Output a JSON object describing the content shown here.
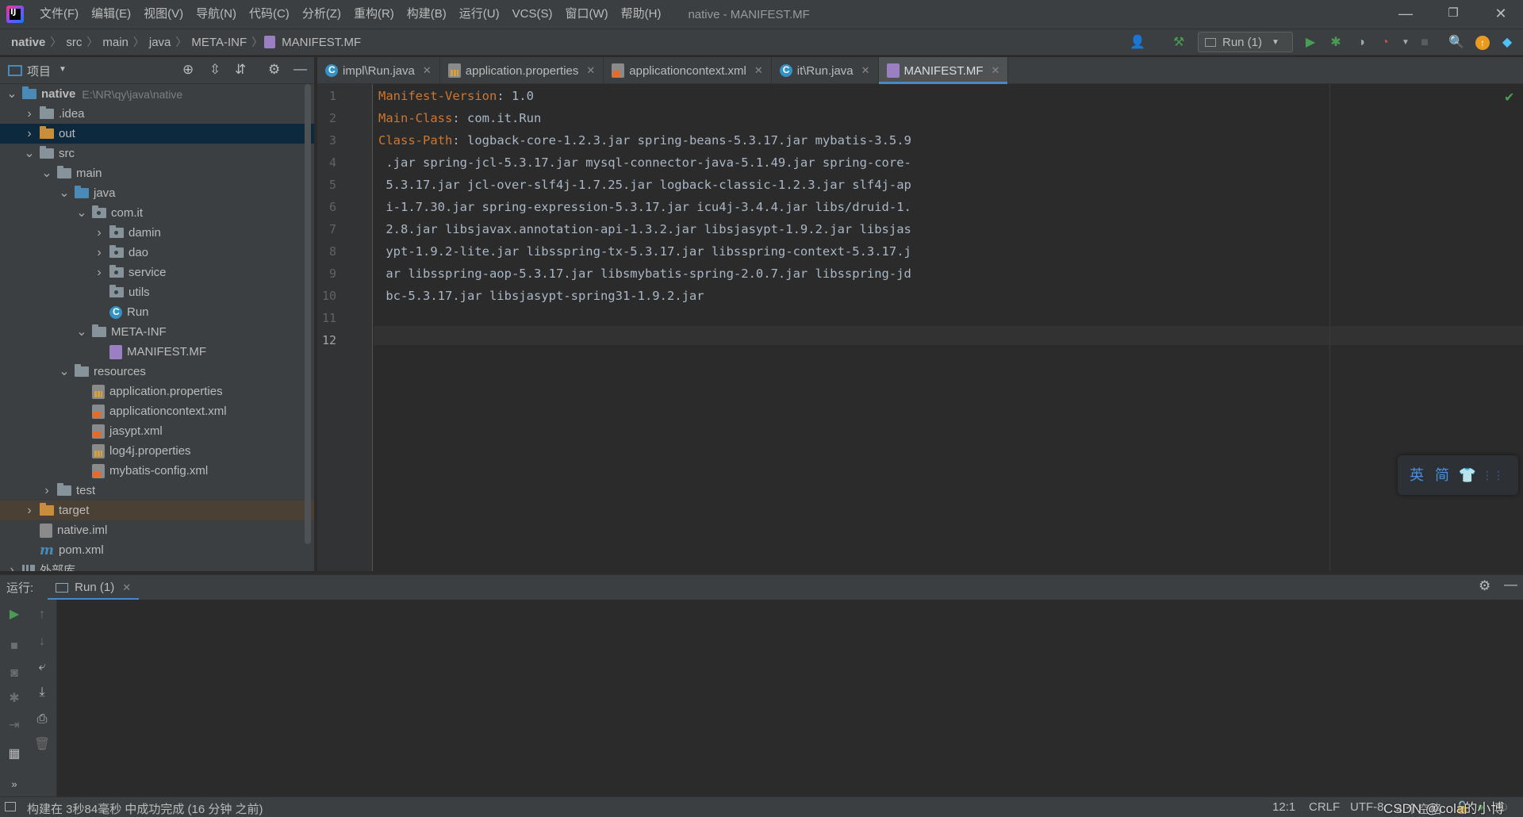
{
  "menu": [
    "文件(F)",
    "编辑(E)",
    "视图(V)",
    "导航(N)",
    "代码(C)",
    "分析(Z)",
    "重构(R)",
    "构建(B)",
    "运行(U)",
    "VCS(S)",
    "窗口(W)",
    "帮助(H)"
  ],
  "window_title": "native - MANIFEST.MF",
  "window_controls": {
    "minimize": "—",
    "restore": "❐",
    "close": "✕"
  },
  "breadcrumb": [
    "native",
    "src",
    "main",
    "java",
    "META-INF",
    "MANIFEST.MF"
  ],
  "run_config": "Run (1)",
  "project_panel": {
    "title": "项目"
  },
  "tree": [
    {
      "label": "native",
      "extra": "E:\\NR\\qy\\java\\native",
      "depth": 0,
      "arrow": "v",
      "icon": "module-folder"
    },
    {
      "label": ".idea",
      "depth": 1,
      "arrow": ">",
      "icon": "folder"
    },
    {
      "label": "out",
      "depth": 1,
      "arrow": ">",
      "icon": "folder-orange"
    },
    {
      "label": "src",
      "depth": 1,
      "arrow": "v",
      "icon": "folder"
    },
    {
      "label": "main",
      "depth": 2,
      "arrow": "v",
      "icon": "folder"
    },
    {
      "label": "java",
      "depth": 3,
      "arrow": "v",
      "icon": "folder-blue"
    },
    {
      "label": "com.it",
      "depth": 4,
      "arrow": "v",
      "icon": "package"
    },
    {
      "label": "damin",
      "depth": 5,
      "arrow": ">",
      "icon": "package"
    },
    {
      "label": "dao",
      "depth": 5,
      "arrow": ">",
      "icon": "package"
    },
    {
      "label": "service",
      "depth": 5,
      "arrow": ">",
      "icon": "package"
    },
    {
      "label": "utils",
      "depth": 5,
      "arrow": "",
      "icon": "package"
    },
    {
      "label": "Run",
      "depth": 5,
      "arrow": "",
      "icon": "java-class"
    },
    {
      "label": "META-INF",
      "depth": 4,
      "arrow": "v",
      "icon": "folder"
    },
    {
      "label": "MANIFEST.MF",
      "depth": 5,
      "arrow": "",
      "icon": "manifest-file"
    },
    {
      "label": "resources",
      "depth": 3,
      "arrow": "v",
      "icon": "resources-folder"
    },
    {
      "label": "application.properties",
      "depth": 4,
      "arrow": "",
      "icon": "properties-file"
    },
    {
      "label": "applicationcontext.xml",
      "depth": 4,
      "arrow": "",
      "icon": "xml-file"
    },
    {
      "label": "jasypt.xml",
      "depth": 4,
      "arrow": "",
      "icon": "xml-file"
    },
    {
      "label": "log4j.properties",
      "depth": 4,
      "arrow": "",
      "icon": "properties-file"
    },
    {
      "label": "mybatis-config.xml",
      "depth": 4,
      "arrow": "",
      "icon": "xml-file"
    },
    {
      "label": "test",
      "depth": 2,
      "arrow": ">",
      "icon": "folder"
    },
    {
      "label": "target",
      "depth": 1,
      "arrow": ">",
      "icon": "folder-orange"
    },
    {
      "label": "native.iml",
      "depth": 1,
      "arrow": "",
      "icon": "iml-file"
    },
    {
      "label": "pom.xml",
      "depth": 1,
      "arrow": "",
      "icon": "maven-file"
    },
    {
      "label": "外部库",
      "depth": 0,
      "arrow": ">",
      "icon": "library"
    }
  ],
  "tabs": [
    {
      "label": "impl\\Run.java",
      "icon": "java-class"
    },
    {
      "label": "application.properties",
      "icon": "properties-file"
    },
    {
      "label": "applicationcontext.xml",
      "icon": "xml-file"
    },
    {
      "label": "it\\Run.java",
      "icon": "java-class"
    },
    {
      "label": "MANIFEST.MF",
      "icon": "manifest-file",
      "active": true
    }
  ],
  "editor": {
    "line_numbers": [
      "1",
      "2",
      "3",
      "4",
      "5",
      "6",
      "7",
      "8",
      "9",
      "10",
      "11",
      "12"
    ],
    "current_line": "12",
    "lines": [
      {
        "key": "Manifest-Version",
        "rest": ": 1.0"
      },
      {
        "key": "Main-Class",
        "rest": ": com.it.Run"
      },
      {
        "key": "Class-Path",
        "rest": ": logback-core-1.2.3.jar spring-beans-5.3.17.jar mybatis-3.5.9"
      },
      {
        "key": "",
        "rest": " .jar spring-jcl-5.3.17.jar mysql-connector-java-5.1.49.jar spring-core-"
      },
      {
        "key": "",
        "rest": " 5.3.17.jar jcl-over-slf4j-1.7.25.jar logback-classic-1.2.3.jar slf4j-ap"
      },
      {
        "key": "",
        "rest": " i-1.7.30.jar spring-expression-5.3.17.jar icu4j-3.4.4.jar libs/druid-1."
      },
      {
        "key": "",
        "rest": " 2.8.jar libsjavax.annotation-api-1.3.2.jar libsjasypt-1.9.2.jar libsjas"
      },
      {
        "key": "",
        "rest": " ypt-1.9.2-lite.jar libsspring-tx-5.3.17.jar libsspring-context-5.3.17.j"
      },
      {
        "key": "",
        "rest": " ar libsspring-aop-5.3.17.jar libsmybatis-spring-2.0.7.jar libsspring-jd"
      },
      {
        "key": "",
        "rest": " bc-5.3.17.jar libsjasypt-spring31-1.9.2.jar"
      },
      {
        "key": "",
        "rest": ""
      },
      {
        "key": "",
        "rest": ""
      }
    ]
  },
  "ime": {
    "lang": "英",
    "mode": "简"
  },
  "run_panel": {
    "label": "运行:",
    "tab": "Run (1)"
  },
  "status": {
    "message": "构建在 3秒84毫秒 中成功完成 (16 分钟 之前)",
    "position": "12:1",
    "line_sep": "CRLF",
    "encoding": "UTF-8",
    "indent": "4 个空格",
    "watermark": "CSDN @cola的小博"
  },
  "colors": {
    "accent": "#4a88c7",
    "keyword": "#cc7832",
    "text": "#a9b7c6",
    "bg": "#2b2b2b",
    "panel": "#3c3f41"
  }
}
